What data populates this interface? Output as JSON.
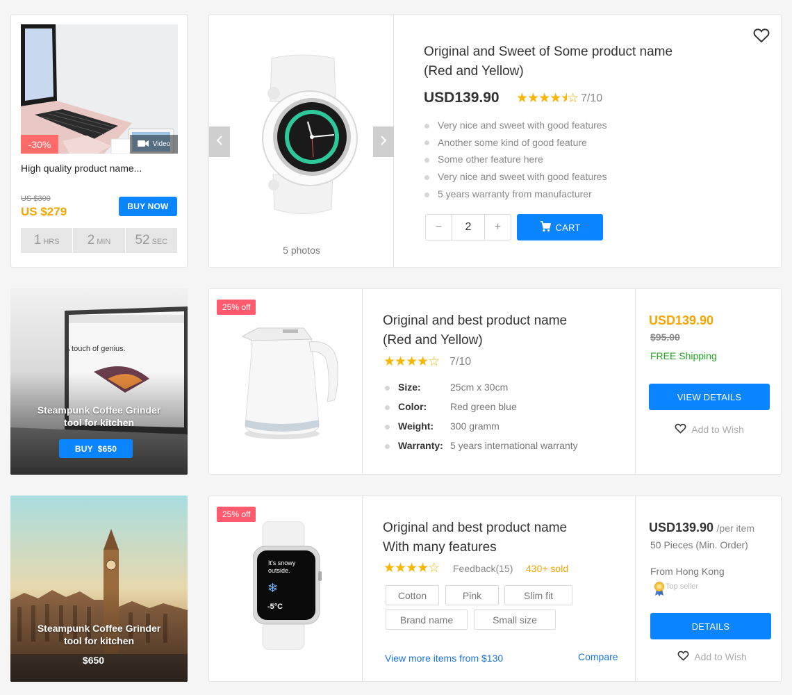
{
  "deal": {
    "discount": "-30%",
    "video_label": "Video",
    "name": "High quality product name...",
    "old_price": "US $300",
    "price": "US $279",
    "buy_label": "BUY NOW",
    "timer": [
      {
        "v": "1",
        "u": "HRS"
      },
      {
        "v": "2",
        "u": "MIN"
      },
      {
        "v": "52",
        "u": "SEC"
      }
    ]
  },
  "featured": {
    "photos": "5 photos",
    "title1": "Original and Sweet of Some product name",
    "title2": "(Red and Yellow)",
    "price": "USD139.90",
    "rating": "7/10",
    "features": [
      "Very nice and sweet with good features",
      "Another some kind of good feature",
      "Some other feature here",
      "Very nice and sweet with good features",
      "5 years warranty from manufacturer"
    ],
    "qty": "2",
    "minus": "−",
    "plus": "+",
    "cart_label": "CART"
  },
  "promo1": {
    "line1": "Steampunk Coffee Grinder",
    "line2": "tool for kitchen",
    "buy_label": "BUY  $650"
  },
  "promo2": {
    "line1": "Steampunk Coffee Grinder",
    "line2": "tool for kitchen",
    "price": "$650"
  },
  "item1": {
    "tag": "25% off",
    "title1": "Original and best product name",
    "title2": "(Red and Yellow)",
    "rating": "7/10",
    "specs": [
      {
        "k": "Size:",
        "v": "25cm x 30cm"
      },
      {
        "k": "Color:",
        "v": "Red green blue"
      },
      {
        "k": "Weight:",
        "v": "300 gramm"
      },
      {
        "k": "Warranty:",
        "v": "5 years international warranty"
      }
    ],
    "price": "USD139.90",
    "old_price": "$95.00",
    "shipping": "FREE Shipping",
    "details_label": "VIEW DETAILS",
    "wish_label": "Add to Wish"
  },
  "item2": {
    "tag": "25% off",
    "watch_text1": "It's snowy",
    "watch_text2": "outside.",
    "watch_temp": "-5°C",
    "title1": "Original and best product name",
    "title2": "With many features",
    "feedback": "Feedback(15)",
    "sold": "430+ sold",
    "chips": [
      "Cotton",
      "Pink",
      "Slim fit",
      "Brand name",
      "Small size"
    ],
    "more_link": "View more items from $130",
    "compare_link": "Compare",
    "price": "USD139.90",
    "per_item": "/per item",
    "min_order": "50 Pieces (Min. Order)",
    "from": "From Hong Kong",
    "seller": "Top seller",
    "details_label": "DETAILS",
    "wish_label": "Add to Wish"
  },
  "colors": {
    "accent": "#0a84ff",
    "price": "#f7a400",
    "sale": "#ff5a6e",
    "star": "#f7b500",
    "free": "#1fa51f"
  }
}
